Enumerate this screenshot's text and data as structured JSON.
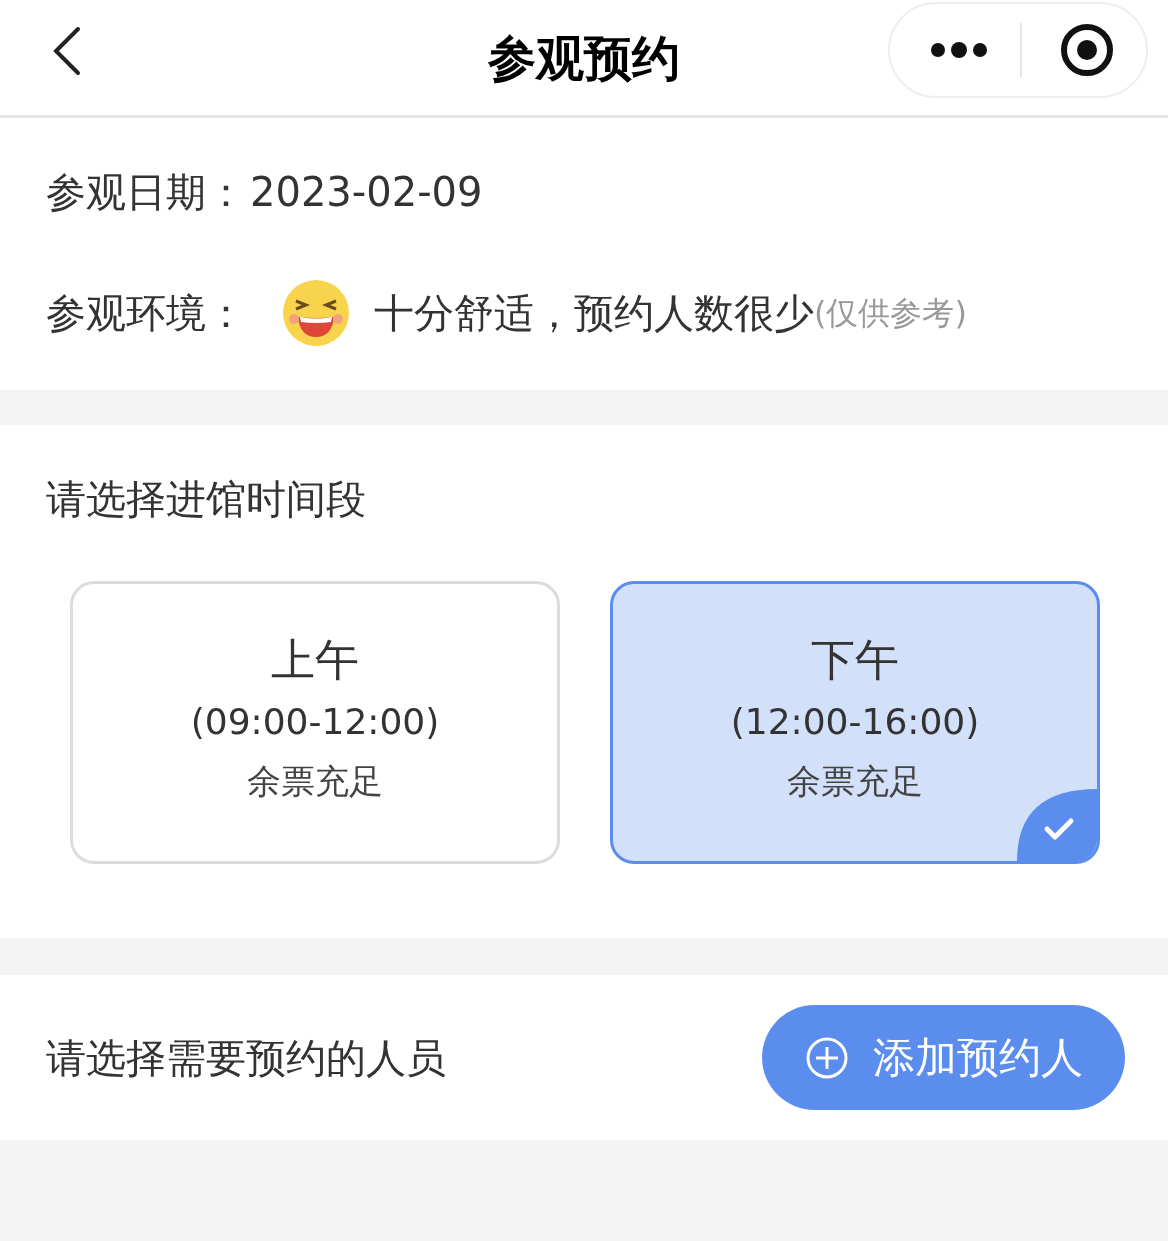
{
  "nav": {
    "title": "参观预约"
  },
  "date": {
    "label": "参观日期：",
    "value": "2023-02-09"
  },
  "environment": {
    "label": "参观环境：",
    "text": "十分舒适，预约人数很少",
    "note": "(仅供参考)"
  },
  "time_section": {
    "title": "请选择进馆时间段",
    "slots": [
      {
        "name": "上午",
        "range": "(09:00-12:00)",
        "availability": "余票充足",
        "selected": false
      },
      {
        "name": "下午",
        "range": "(12:00-16:00)",
        "availability": "余票充足",
        "selected": true
      }
    ]
  },
  "people_section": {
    "title": "请选择需要预约的人员",
    "button": "添加预约人"
  }
}
